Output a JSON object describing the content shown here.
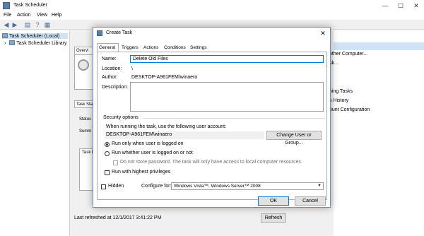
{
  "main_window": {
    "title": "Task Scheduler",
    "controls": {
      "minimize": "—",
      "maximize": "☐",
      "close": "✕"
    },
    "menu": [
      "File",
      "Action",
      "View",
      "Help"
    ],
    "toolbar_icons": [
      "back-arrow",
      "forward-arrow",
      "folder",
      "help",
      "properties"
    ]
  },
  "tree": {
    "items": [
      "Task Scheduler (Local)",
      "Task Scheduler Library"
    ],
    "expander": "›"
  },
  "center": {
    "overview_tab": "Overvi",
    "task_status_tab": "Task Sta",
    "status_label": "Status",
    "summary_label": "Summ",
    "task_list_label": "Task l",
    "last_refreshed": "Last refreshed at 12/1/2017 3:41:22 PM",
    "refresh_button": "Refresh"
  },
  "actions_pane": {
    "items": [
      "other Computer...",
      "sk...",
      "ning Tasks",
      "s History",
      "ount Configuration"
    ]
  },
  "dialog": {
    "title": "Create Task",
    "close": "✕",
    "tabs": [
      "General",
      "Triggers",
      "Actions",
      "Conditions",
      "Settings"
    ],
    "general": {
      "name_label": "Name:",
      "name_value": "Delete Old Files",
      "location_label": "Location:",
      "location_value": "\\",
      "author_label": "Author:",
      "author_value": "DESKTOP-A961FEM\\winaero",
      "description_label": "Description:",
      "security_heading": "Security options",
      "user_account_prompt": "When running the task, use the following user account:",
      "user_account": "DESKTOP-A961FEM\\winaero",
      "change_user_button": "Change User or Group...",
      "radio_logged_on": "Run only when user is logged on",
      "radio_logged_on_or_not": "Run whether user is logged on or not",
      "no_store_password": "Do not store password.  The task will only have access to local computer resources.",
      "highest_privileges": "Run with highest privileges",
      "hidden_label": "Hidden",
      "configure_for_label": "Configure for:",
      "configure_for_value": "Windows Vista™, Windows Server™ 2008"
    },
    "ok_button": "OK",
    "cancel_button": "Cancel"
  },
  "colors": {
    "dialog_border": "#6b8fc4",
    "selection": "#cfe2f7",
    "primary_button_border": "#0078d7"
  }
}
